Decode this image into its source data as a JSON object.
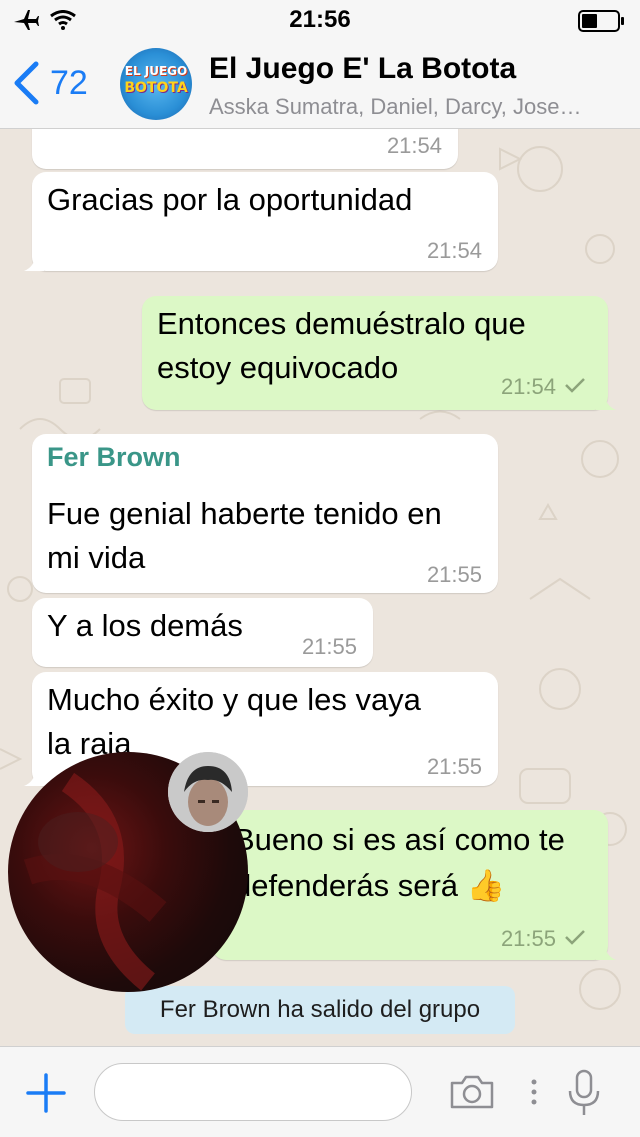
{
  "status_bar": {
    "time": "21:56"
  },
  "header": {
    "back_count": "72",
    "avatar_line1": "EL JUEGO",
    "avatar_line2": "BOTOTA",
    "title": "El Juego E' La Botota",
    "subtitle": "Asska Sumatra, Daniel, Darcy, Jose…"
  },
  "messages": [
    {
      "direction": "in",
      "text": "",
      "time": "21:54"
    },
    {
      "direction": "in",
      "text": "Gracias por la oportunidad",
      "time": "21:54"
    },
    {
      "direction": "out",
      "lines": [
        "Entonces demuéstralo que",
        "estoy equivocado"
      ],
      "time": "21:54"
    },
    {
      "direction": "in",
      "sender": "Fer Brown",
      "lines": [
        "Fue genial haberte tenido en",
        "mi vida"
      ],
      "time": "21:55"
    },
    {
      "direction": "in",
      "text": "Y a los demás",
      "time": "21:55"
    },
    {
      "direction": "in",
      "lines": [
        "Mucho éxito y que les vaya",
        "la raja"
      ],
      "time": "21:55"
    },
    {
      "direction": "out",
      "lines": [
        "Bueno si es así como te",
        "defenderás será 👍"
      ],
      "time": "21:55"
    }
  ],
  "system_message": "Fer Brown ha salido del grupo",
  "colors": {
    "accent": "#1a7cf5",
    "sender_name": "#3a9688",
    "outgoing_bubble": "#dcf8c6",
    "incoming_bubble": "#ffffff",
    "system_bubble": "#d4eaf4",
    "wallpaper": "#ece5dd"
  },
  "icons": {
    "status": [
      "airplane-icon",
      "wifi-icon",
      "battery-icon"
    ],
    "header": [
      "chevron-left-icon"
    ],
    "input": [
      "plus-icon",
      "camera-icon",
      "more-vertical-icon",
      "microphone-icon"
    ],
    "message": [
      "double-check-icon",
      "thumbs-up-emoji"
    ]
  }
}
